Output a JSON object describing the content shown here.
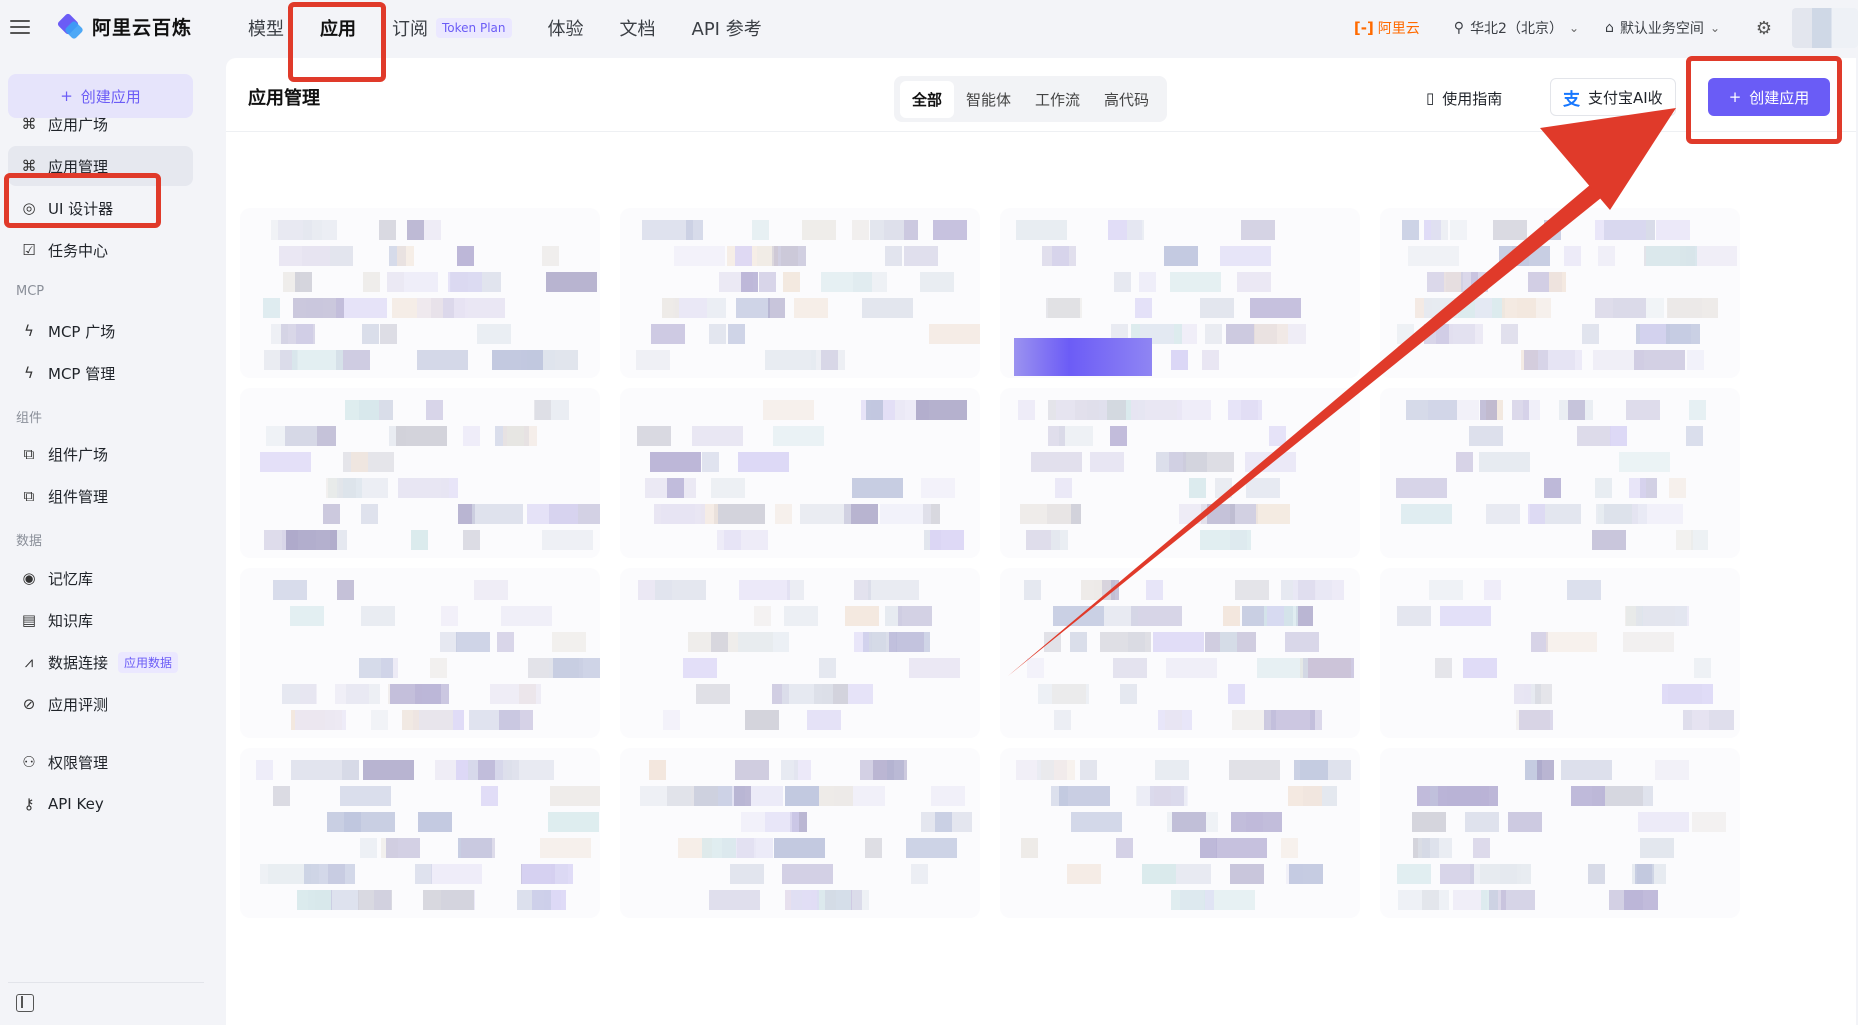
{
  "topbar": {
    "brand": "阿里云百炼",
    "nav": [
      {
        "label": "模型"
      },
      {
        "label": "应用"
      },
      {
        "label": "订阅"
      },
      {
        "label": "体验"
      },
      {
        "label": "文档"
      },
      {
        "label": "API 参考"
      }
    ],
    "token_badge": "Token Plan",
    "aliyun_label": "阿里云",
    "region": "华北2（北京）",
    "workspace": "默认业务空间"
  },
  "sidebar": {
    "create_label": "创建应用",
    "items": [
      {
        "label": "应用广场",
        "icon": "apps-icon"
      },
      {
        "label": "应用管理",
        "icon": "apps-icon"
      },
      {
        "label": "UI 设计器",
        "icon": "palette-icon"
      },
      {
        "label": "任务中心",
        "icon": "task-icon"
      }
    ],
    "group_mcp": "MCP",
    "mcp_items": [
      {
        "label": "MCP 广场",
        "icon": "mcp-icon"
      },
      {
        "label": "MCP 管理",
        "icon": "mcp-manage-icon"
      }
    ],
    "group_component": "组件",
    "component_items": [
      {
        "label": "组件广场",
        "icon": "component-icon"
      },
      {
        "label": "组件管理",
        "icon": "component-manage-icon"
      }
    ],
    "group_data": "数据",
    "data_items": [
      {
        "label": "记忆库",
        "icon": "memory-icon"
      },
      {
        "label": "知识库",
        "icon": "book-icon"
      },
      {
        "label": "数据连接",
        "icon": "chart-icon",
        "tag": "应用数据"
      },
      {
        "label": "应用评测",
        "icon": "compass-icon"
      }
    ],
    "bottom_items": [
      {
        "label": "权限管理",
        "icon": "user-icon"
      },
      {
        "label": "API Key",
        "icon": "key-icon"
      }
    ]
  },
  "main": {
    "title": "应用管理",
    "tabs": [
      "全部",
      "智能体",
      "工作流",
      "高代码"
    ],
    "active_tab": "全部",
    "guide_label": "使用指南",
    "alipay_label": "支付宝AI收",
    "create_label": "创建应用"
  },
  "colors": {
    "accent": "#6a5cf6",
    "annotation": "#e03a2a"
  }
}
